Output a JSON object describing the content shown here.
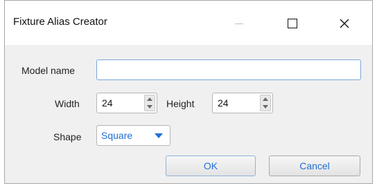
{
  "window": {
    "title": "Fixture Alias Creator",
    "controls": {
      "minimize": "—",
      "maximize": "☐",
      "close": "✕"
    }
  },
  "form": {
    "model_name": {
      "label": "Model name",
      "value": ""
    },
    "width": {
      "label": "Width",
      "value": "24"
    },
    "height": {
      "label": "Height",
      "value": "24"
    },
    "shape": {
      "label": "Shape",
      "value": "Square"
    }
  },
  "buttons": {
    "ok": "OK",
    "cancel": "Cancel"
  },
  "colors": {
    "accent": "#1f6fd6",
    "focus_border": "#7aa7dd"
  }
}
